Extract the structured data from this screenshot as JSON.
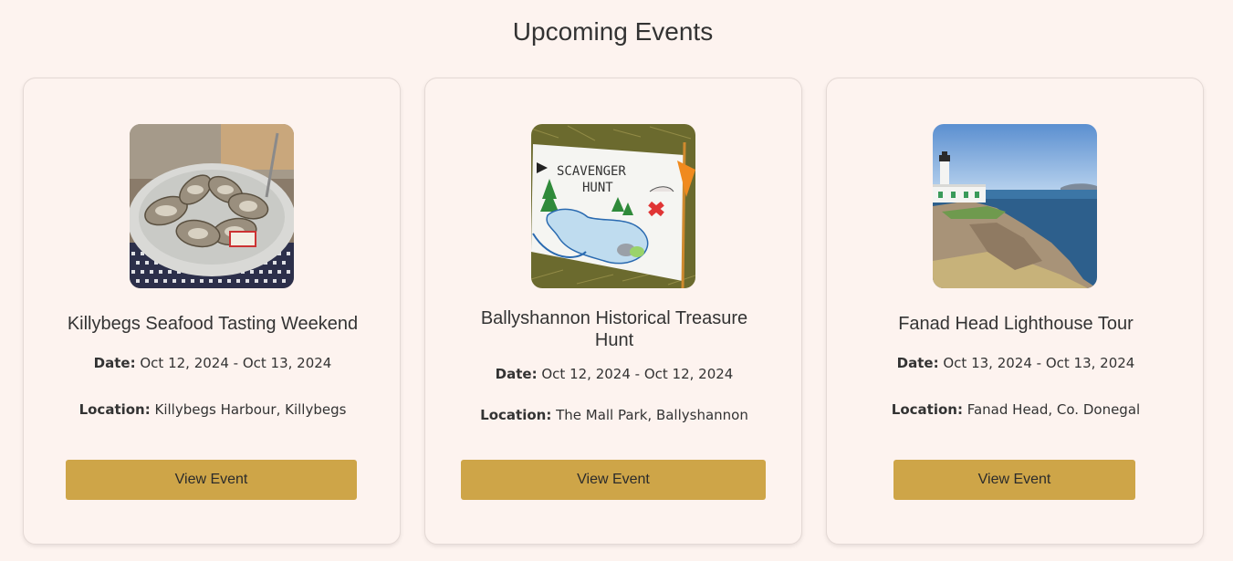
{
  "page": {
    "heading": "Upcoming Events"
  },
  "colors": {
    "background": "#fdf3ef",
    "button": "#cea548",
    "text": "#333333"
  },
  "events": [
    {
      "title": "Killybegs Seafood Tasting Weekend",
      "date_label": "Date:",
      "date_value": "Oct 12, 2024 - Oct 13, 2024",
      "location_label": "Location:",
      "location_value": "Killybegs Harbour, Killybegs",
      "button_label": "View Event",
      "image": "oysters-photo"
    },
    {
      "title": "Ballyshannon Historical Treasure Hunt",
      "date_label": "Date:",
      "date_value": "Oct 12, 2024 - Oct 12, 2024",
      "location_label": "Location:",
      "location_value": "The Mall Park, Ballyshannon",
      "button_label": "View Event",
      "image": "scavenger-hunt-map-photo",
      "image_text": [
        "SCAVENGER",
        "HUNT"
      ]
    },
    {
      "title": "Fanad Head Lighthouse Tour",
      "date_label": "Date:",
      "date_value": "Oct 13, 2024 - Oct 13, 2024",
      "location_label": "Location:",
      "location_value": "Fanad Head, Co. Donegal",
      "button_label": "View Event",
      "image": "lighthouse-photo"
    }
  ]
}
